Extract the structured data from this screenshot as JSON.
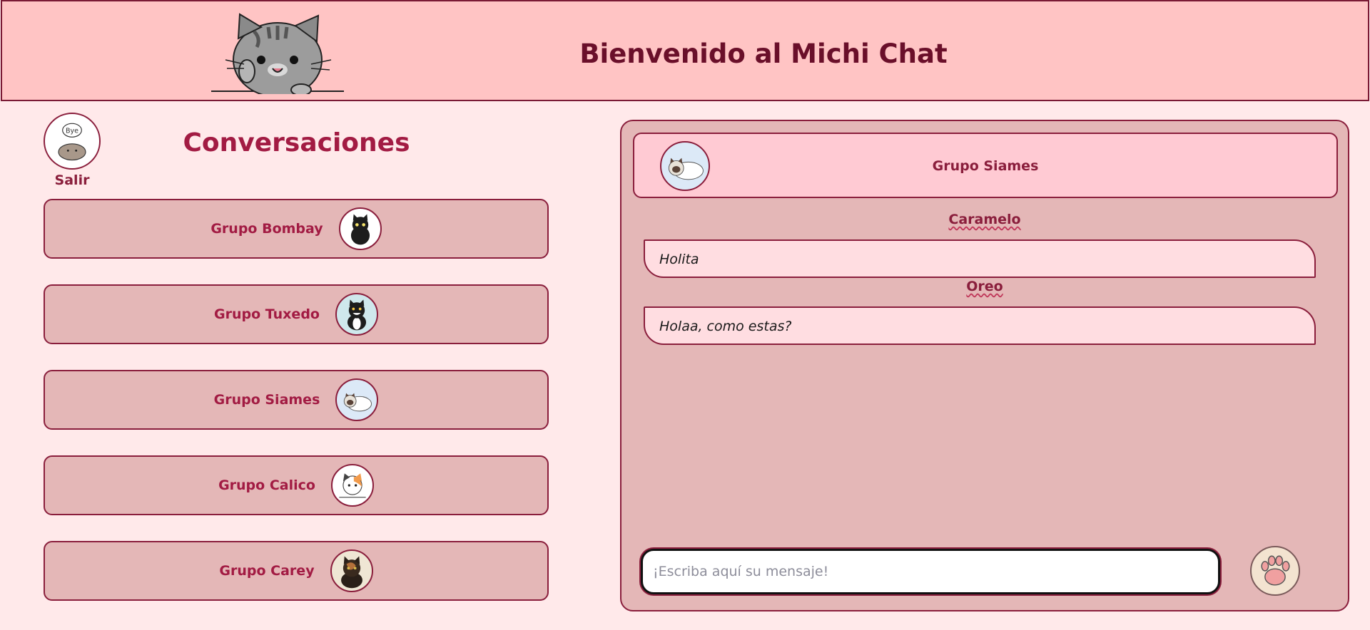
{
  "header": {
    "title": "Bienvenido al Michi Chat",
    "mascot_icon": "cat-mascot-icon"
  },
  "sidebar": {
    "logout_label": "Salir",
    "logout_bubble": "Bye",
    "title": "Conversaciones",
    "items": [
      {
        "label": "Grupo Bombay",
        "icon": "black-cat-icon"
      },
      {
        "label": "Grupo Tuxedo",
        "icon": "tuxedo-cat-icon"
      },
      {
        "label": "Grupo Siames",
        "icon": "siamese-cat-icon"
      },
      {
        "label": "Grupo Calico",
        "icon": "calico-cat-icon"
      },
      {
        "label": "Grupo Carey",
        "icon": "tortoiseshell-cat-icon"
      }
    ]
  },
  "chat": {
    "group_name": "Grupo Siames",
    "group_icon": "siamese-cat-icon",
    "messages": [
      {
        "sender": "Caramelo",
        "text": "Holita"
      },
      {
        "sender": "Oreo",
        "text": "Holaa, como estas?"
      }
    ],
    "input_placeholder": "¡Escriba aquí su mensaje!",
    "send_icon": "paw-icon"
  },
  "colors": {
    "background": "#ffe9ea",
    "header": "#ffc4c4",
    "panel": "#e4b7b7",
    "accent": "#8a1e3c",
    "title": "#6a0f2a"
  }
}
